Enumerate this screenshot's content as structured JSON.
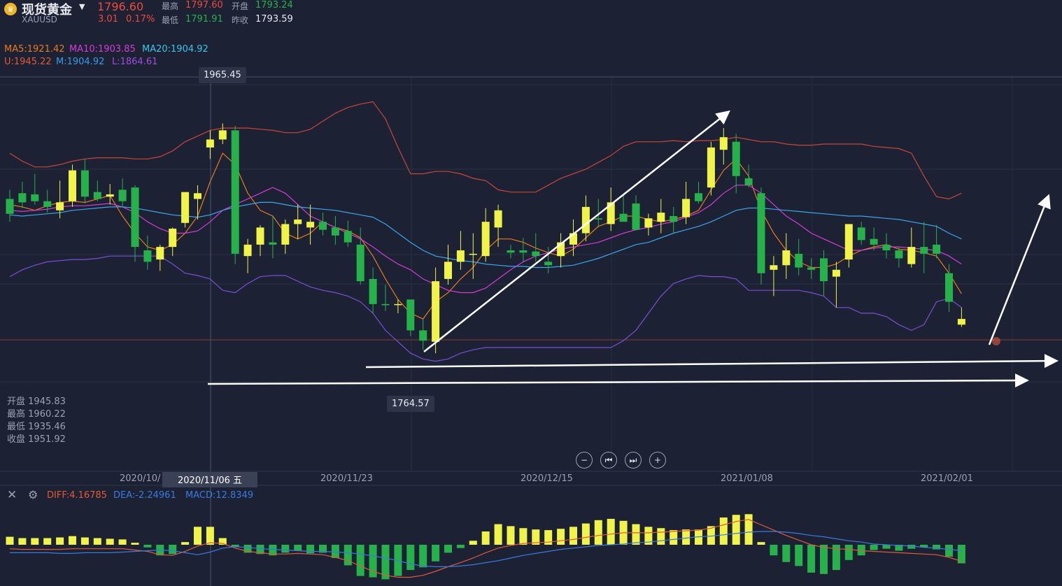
{
  "header": {
    "name": "现货黄金",
    "symbol": "XAUUSD",
    "price": "1796.60",
    "change": "3.01",
    "change_pct": "0.17%",
    "high_label": "最高",
    "high": "1797.60",
    "low_label": "最低",
    "low": "1791.91",
    "open_label": "开盘",
    "open": "1793.24",
    "prev_label": "昨收",
    "prev": "1793.59"
  },
  "indicators": {
    "ma5": "MA5:1921.42",
    "ma10": "MA10:1903.85",
    "ma20": "MA20:1904.92",
    "u": "U:1945.22",
    "m": "M:1904.92",
    "l": "L:1864.61"
  },
  "colors": {
    "up": "#f0f34a",
    "down": "#27b14a",
    "ma5": "#e87a1e",
    "ma10": "#d63cd6",
    "ma20": "#3aa7e8",
    "boll_u": "#c9463a",
    "boll_l": "#7a4ed6",
    "diff": "#e05a3a",
    "dea": "#3a7ae0",
    "arrow": "#ffffff"
  },
  "annotations": {
    "max_tag": "1965.45",
    "min_tag": "1764.57",
    "crosshair_date": "2020/11/06 五"
  },
  "ohlc_panel": [
    {
      "label": "开盘",
      "value": "1945.83"
    },
    {
      "label": "最高",
      "value": "1960.22"
    },
    {
      "label": "最低",
      "value": "1935.46"
    },
    {
      "label": "收盘",
      "value": "1951.92"
    }
  ],
  "x_axis": {
    "labels": [
      "2020/10/",
      "2020/11/23",
      "2020/12/15",
      "2021/01/08",
      "2021/02/01"
    ]
  },
  "macd": {
    "diff": "DIFF:4.16785",
    "dea": "DEA:-2.24961",
    "macd": "MACD:12.8349"
  },
  "controls": [
    "zoom-out",
    "step-back",
    "step-forward",
    "zoom-in"
  ],
  "chart_data": {
    "type": "candlestick",
    "series": [
      {
        "name": "K",
        "values": [
          [
            1900,
            1908,
            1880,
            1887
          ],
          [
            1905,
            1915,
            1892,
            1897
          ],
          [
            1904,
            1922,
            1895,
            1898
          ],
          [
            1898,
            1908,
            1888,
            1893
          ],
          [
            1890,
            1916,
            1883,
            1897
          ],
          [
            1898,
            1930,
            1893,
            1925
          ],
          [
            1925,
            1935,
            1896,
            1902
          ],
          [
            1906,
            1916,
            1898,
            1900
          ],
          [
            1902,
            1913,
            1895,
            1904
          ],
          [
            1908,
            1918,
            1893,
            1898
          ],
          [
            1910,
            1912,
            1845,
            1858
          ],
          [
            1855,
            1868,
            1838,
            1845
          ],
          [
            1847,
            1860,
            1837,
            1858
          ],
          [
            1858,
            1875,
            1850,
            1874
          ],
          [
            1879,
            1893,
            1875,
            1906
          ],
          [
            1900,
            1912,
            1882,
            1905
          ],
          [
            1945,
            1960,
            1935,
            1952
          ],
          [
            1952,
            1966,
            1948,
            1960
          ],
          [
            1960,
            1964,
            1843,
            1852
          ],
          [
            1850,
            1865,
            1835,
            1860
          ],
          [
            1860,
            1877,
            1850,
            1875
          ],
          [
            1862,
            1885,
            1848,
            1860
          ],
          [
            1860,
            1882,
            1852,
            1878
          ],
          [
            1878,
            1895,
            1865,
            1882
          ],
          [
            1875,
            1895,
            1860,
            1880
          ],
          [
            1880,
            1888,
            1868,
            1873
          ],
          [
            1875,
            1885,
            1860,
            1868
          ],
          [
            1872,
            1881,
            1858,
            1862
          ],
          [
            1860,
            1875,
            1825,
            1828
          ],
          [
            1830,
            1840,
            1800,
            1808
          ],
          [
            1808,
            1825,
            1802,
            1807
          ],
          [
            1808,
            1812,
            1800,
            1808
          ],
          [
            1812,
            1812,
            1780,
            1785
          ],
          [
            1785,
            1795,
            1768,
            1776
          ],
          [
            1775,
            1840,
            1765,
            1828
          ],
          [
            1830,
            1860,
            1825,
            1845
          ],
          [
            1845,
            1872,
            1838,
            1855
          ],
          [
            1852,
            1870,
            1830,
            1852
          ],
          [
            1850,
            1892,
            1845,
            1880
          ],
          [
            1875,
            1895,
            1858,
            1890
          ],
          [
            1855,
            1860,
            1848,
            1853
          ],
          [
            1855,
            1866,
            1845,
            1853
          ],
          [
            1854,
            1870,
            1845,
            1850
          ],
          [
            1845,
            1858,
            1835,
            1842
          ],
          [
            1850,
            1870,
            1840,
            1862
          ],
          [
            1860,
            1882,
            1850,
            1870
          ],
          [
            1870,
            1903,
            1863,
            1893
          ],
          [
            1883,
            1900,
            1875,
            1882
          ],
          [
            1878,
            1910,
            1872,
            1897
          ],
          [
            1887,
            1904,
            1882,
            1880
          ],
          [
            1896,
            1903,
            1880,
            1873
          ],
          [
            1875,
            1887,
            1868,
            1883
          ],
          [
            1880,
            1900,
            1870,
            1888
          ],
          [
            1885,
            1893,
            1870,
            1880
          ],
          [
            1884,
            1915,
            1878,
            1900
          ],
          [
            1905,
            1915,
            1896,
            1898
          ],
          [
            1910,
            1950,
            1903,
            1945
          ],
          [
            1943,
            1962,
            1930,
            1954
          ],
          [
            1950,
            1957,
            1905,
            1920
          ],
          [
            1918,
            1930,
            1910,
            1912
          ],
          [
            1905,
            1910,
            1825,
            1835
          ],
          [
            1838,
            1850,
            1815,
            1842
          ],
          [
            1842,
            1870,
            1830,
            1855
          ],
          [
            1852,
            1865,
            1833,
            1840
          ],
          [
            1840,
            1848,
            1830,
            1838
          ],
          [
            1848,
            1855,
            1815,
            1828
          ],
          [
            1832,
            1845,
            1805,
            1838
          ],
          [
            1847,
            1878,
            1840,
            1878
          ],
          [
            1875,
            1880,
            1860,
            1864
          ],
          [
            1865,
            1875,
            1855,
            1860
          ],
          [
            1860,
            1870,
            1848,
            1855
          ],
          [
            1855,
            1858,
            1840,
            1848
          ],
          [
            1843,
            1875,
            1840,
            1858
          ],
          [
            1858,
            1880,
            1835,
            1852
          ],
          [
            1860,
            1877,
            1848,
            1852
          ],
          [
            1835,
            1843,
            1801,
            1810
          ],
          [
            1790,
            1805,
            1788,
            1795
          ]
        ]
      },
      {
        "name": "MA5",
        "values": [
          1895,
          1893,
          1890,
          1894,
          1897,
          1898,
          1897,
          1900,
          1903,
          1885,
          1870,
          1858,
          1855,
          1860,
          1870,
          1885,
          1915,
          1940,
          1930,
          1905,
          1890,
          1885,
          1870,
          1865,
          1870,
          1880,
          1875,
          1872,
          1866,
          1850,
          1830,
          1812,
          1800,
          1795,
          1810,
          1818,
          1830,
          1840,
          1855,
          1865,
          1865,
          1862,
          1857,
          1853,
          1850,
          1856,
          1866,
          1876,
          1880,
          1885,
          1885,
          1882,
          1880,
          1882,
          1885,
          1890,
          1908,
          1925,
          1935,
          1920,
          1890,
          1870,
          1855,
          1845,
          1840,
          1840,
          1843,
          1850,
          1855,
          1858,
          1860,
          1856,
          1855,
          1853,
          1850,
          1835,
          1817
        ]
      },
      {
        "name": "MA10",
        "values": [
          1890,
          1889,
          1890,
          1891,
          1893,
          1894,
          1894,
          1895,
          1896,
          1893,
          1888,
          1880,
          1874,
          1870,
          1870,
          1872,
          1880,
          1890,
          1895,
          1900,
          1905,
          1910,
          1905,
          1895,
          1885,
          1880,
          1875,
          1870,
          1865,
          1858,
          1850,
          1843,
          1838,
          1830,
          1825,
          1820,
          1818,
          1818,
          1822,
          1830,
          1838,
          1845,
          1850,
          1853,
          1856,
          1858,
          1860,
          1862,
          1866,
          1870,
          1873,
          1875,
          1878,
          1880,
          1884,
          1888,
          1895,
          1905,
          1912,
          1912,
          1905,
          1895,
          1885,
          1878,
          1870,
          1865,
          1860,
          1855,
          1855,
          1857,
          1858,
          1858,
          1857,
          1856,
          1855,
          1850,
          1843
        ]
      },
      {
        "name": "BOLL_M",
        "values": [
          1886,
          1885,
          1886,
          1887,
          1888,
          1890,
          1891,
          1892,
          1893,
          1893,
          1892,
          1890,
          1888,
          1886,
          1885,
          1884,
          1886,
          1890,
          1893,
          1895,
          1897,
          1897,
          1895,
          1893,
          1892,
          1891,
          1890,
          1888,
          1886,
          1884,
          1878,
          1870,
          1862,
          1855,
          1850,
          1848,
          1846,
          1845,
          1843,
          1842,
          1841,
          1841,
          1840,
          1840,
          1841,
          1842,
          1845,
          1848,
          1852,
          1856,
          1860,
          1862,
          1866,
          1870,
          1873,
          1876,
          1880,
          1885,
          1890,
          1892,
          1892,
          1891,
          1890,
          1889,
          1888,
          1887,
          1886,
          1885,
          1885,
          1884,
          1883,
          1882,
          1880,
          1878,
          1876,
          1870,
          1865
        ]
      },
      {
        "name": "BOLL_U",
        "values": [
          1940,
          1933,
          1928,
          1928,
          1930,
          1933,
          1935,
          1936,
          1936,
          1936,
          1935,
          1935,
          1937,
          1942,
          1950,
          1955,
          1960,
          1962,
          1962,
          1962,
          1961,
          1960,
          1958,
          1958,
          1961,
          1968,
          1975,
          1980,
          1983,
          1985,
          1970,
          1945,
          1922,
          1922,
          1924,
          1924,
          1922,
          1918,
          1916,
          1908,
          1906,
          1906,
          1906,
          1912,
          1918,
          1922,
          1926,
          1932,
          1938,
          1946,
          1950,
          1950,
          1950,
          1951,
          1950,
          1951,
          1951,
          1952,
          1954,
          1952,
          1950,
          1950,
          1948,
          1947,
          1947,
          1948,
          1948,
          1948,
          1948,
          1946,
          1945,
          1944,
          1940,
          1920,
          1902,
          1900,
          1905
        ]
      },
      {
        "name": "BOLL_L",
        "values": [
          1832,
          1838,
          1842,
          1845,
          1846,
          1847,
          1847,
          1848,
          1850,
          1850,
          1850,
          1850,
          1850,
          1843,
          1835,
          1833,
          1830,
          1820,
          1818,
          1826,
          1832,
          1833,
          1833,
          1828,
          1823,
          1820,
          1818,
          1815,
          1810,
          1800,
          1785,
          1775,
          1765,
          1760,
          1758,
          1760,
          1765,
          1768,
          1770,
          1770,
          1770,
          1770,
          1770,
          1770,
          1770,
          1770,
          1770,
          1770,
          1770,
          1776,
          1785,
          1800,
          1815,
          1826,
          1830,
          1833,
          1832,
          1832,
          1830,
          1820,
          1820,
          1820,
          1820,
          1820,
          1818,
          1815,
          1805,
          1805,
          1800,
          1800,
          1797,
          1790,
          1785,
          1790,
          1810,
          1813,
          1805
        ]
      }
    ],
    "macd": {
      "bars": [
        1.2,
        1.0,
        1.0,
        1.0,
        1.1,
        1.3,
        1.1,
        1.0,
        0.9,
        0.8,
        0.3,
        -0.4,
        -1.6,
        -1.4,
        0.4,
        2.7,
        2.7,
        1.0,
        -0.3,
        -1.2,
        -1.4,
        -1.6,
        -1.2,
        -0.9,
        -1.3,
        -1.2,
        -2.0,
        -3.1,
        -4.7,
        -4.9,
        -5.2,
        -4.7,
        -3.8,
        -3.4,
        -2.5,
        -1.2,
        -0.5,
        0.6,
        2.0,
        3.1,
        2.8,
        2.5,
        2.3,
        2.2,
        2.4,
        2.7,
        3.2,
        3.7,
        3.9,
        3.6,
        3.1,
        2.7,
        2.5,
        2.2,
        2.3,
        2.3,
        2.8,
        4.1,
        4.5,
        4.6,
        0.4,
        -1.6,
        -2.6,
        -3.2,
        -4.2,
        -4.4,
        -3.8,
        -2.3,
        -1.6,
        -0.8,
        -0.6,
        -0.9,
        -0.6,
        -0.4,
        -0.7,
        -1.8,
        -2.8
      ],
      "diff": [
        -0.6,
        -0.7,
        -0.7,
        -0.7,
        -0.7,
        -0.6,
        -0.6,
        -0.6,
        -0.6,
        -0.6,
        -0.8,
        -1.0,
        -1.5,
        -1.6,
        -1.0,
        -0.2,
        0.3,
        0.2,
        -0.5,
        -1.0,
        -1.2,
        -1.4,
        -1.4,
        -1.3,
        -1.4,
        -1.5,
        -1.9,
        -2.4,
        -3.2,
        -4.0,
        -4.6,
        -4.9,
        -4.9,
        -4.6,
        -4.0,
        -3.3,
        -2.7,
        -2.0,
        -1.2,
        -0.5,
        -0.1,
        0.2,
        0.3,
        0.4,
        0.6,
        0.8,
        1.1,
        1.4,
        1.6,
        1.8,
        1.8,
        1.8,
        1.9,
        2.0,
        2.1,
        2.2,
        2.5,
        3.0,
        3.5,
        3.8,
        3.0,
        2.2,
        1.4,
        0.7,
        0.0,
        -0.4,
        -0.6,
        -0.7,
        -0.9,
        -1.0,
        -1.1,
        -1.2,
        -1.3,
        -1.4,
        -1.5,
        -1.9,
        -2.5
      ],
      "dea": [
        -1.2,
        -1.2,
        -1.2,
        -1.2,
        -1.3,
        -1.3,
        -1.2,
        -1.2,
        -1.2,
        -1.1,
        -1.0,
        -0.9,
        -0.8,
        -0.9,
        -1.2,
        -1.5,
        -1.1,
        -0.5,
        -0.3,
        -0.4,
        -0.6,
        -0.7,
        -0.8,
        -0.9,
        -1.0,
        -1.0,
        -1.1,
        -1.2,
        -1.4,
        -1.7,
        -2.0,
        -2.4,
        -2.9,
        -3.2,
        -3.3,
        -3.3,
        -3.2,
        -3.0,
        -2.7,
        -2.4,
        -2.0,
        -1.6,
        -1.3,
        -1.0,
        -0.7,
        -0.5,
        -0.3,
        -0.1,
        0.0,
        0.1,
        0.3,
        0.4,
        0.6,
        0.8,
        1.0,
        1.2,
        1.3,
        1.5,
        1.7,
        1.9,
        2.0,
        2.0,
        1.9,
        1.7,
        1.4,
        1.2,
        0.9,
        0.6,
        0.4,
        0.1,
        0.0,
        -0.1,
        -0.2,
        -0.4,
        -0.5,
        -0.7,
        -0.9
      ]
    },
    "ylim": [
      1740,
      2000
    ],
    "macd_ylim": [
      -6,
      6
    ],
    "x_labels": [
      "2020/10/",
      "2020/11/23",
      "2020/12/15",
      "2021/01/08",
      "2021/02/01"
    ],
    "grid": true
  }
}
